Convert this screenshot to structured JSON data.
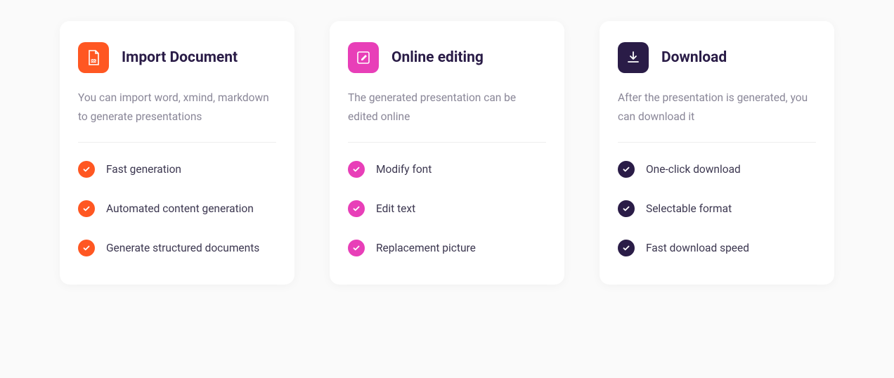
{
  "cards": [
    {
      "title": "Import Document",
      "desc": "You can import word, xmind, markdown to generate presentations",
      "features": [
        "Fast generation",
        "Automated content generation",
        "Generate structured documents"
      ]
    },
    {
      "title": "Online editing",
      "desc": "The generated presentation can be edited online",
      "features": [
        "Modify font",
        "Edit text",
        "Replacement picture"
      ]
    },
    {
      "title": "Download",
      "desc": "After the presentation is generated, you can download it",
      "features": [
        "One-click download",
        "Selectable format",
        "Fast download speed"
      ]
    }
  ]
}
